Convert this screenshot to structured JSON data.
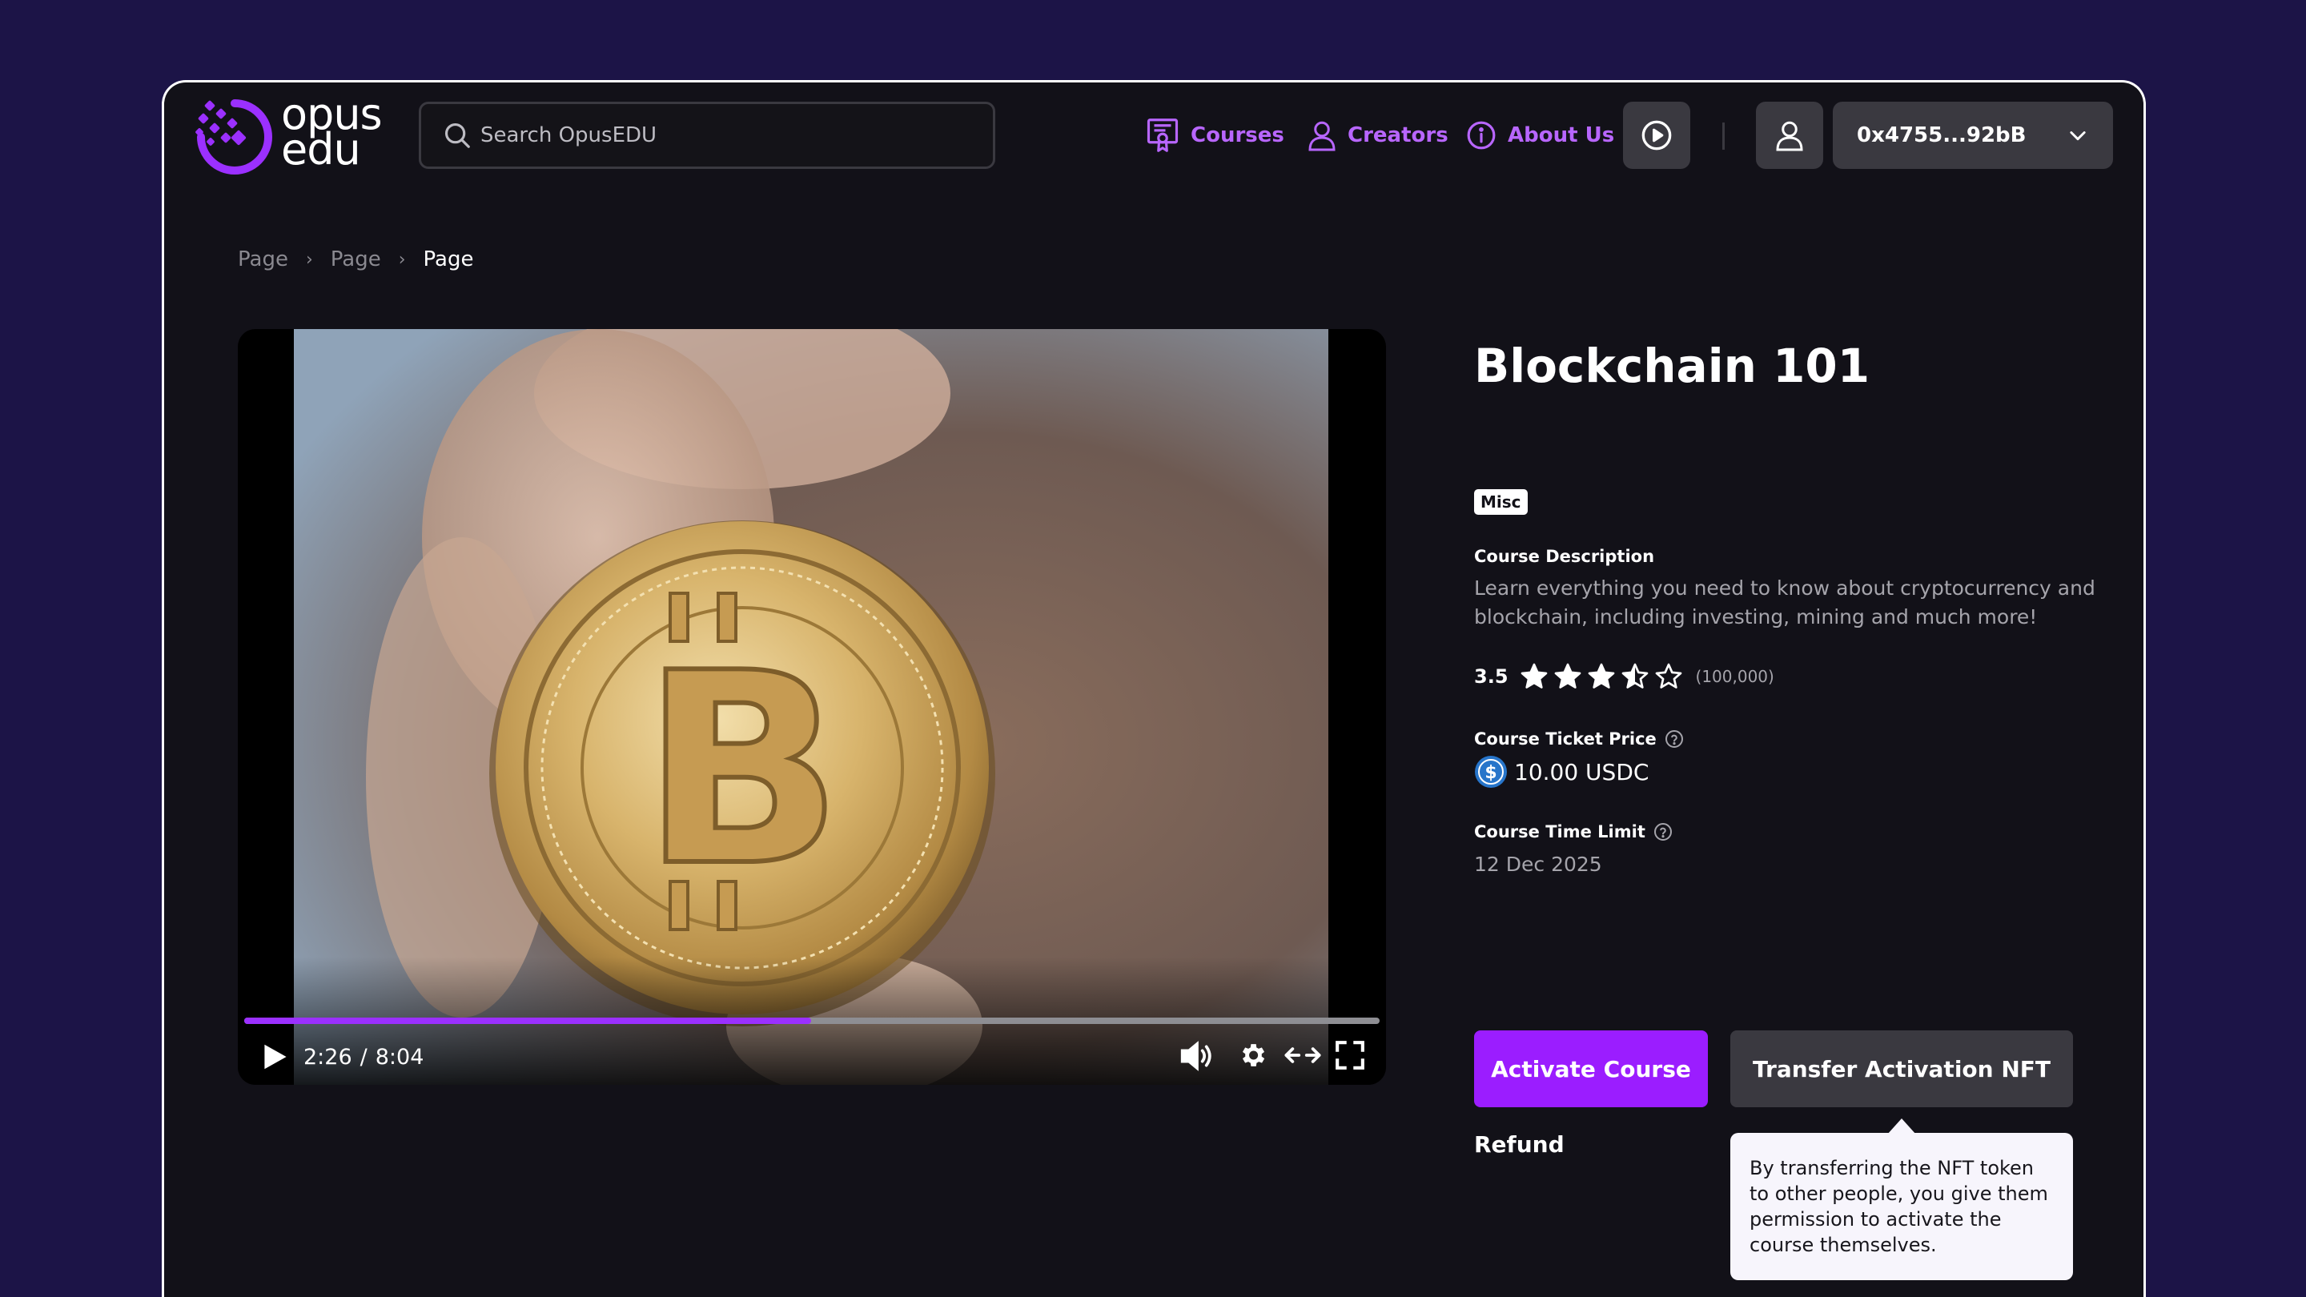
{
  "header": {
    "logo_line1": "opus",
    "logo_line2": "edu",
    "search_placeholder": "Search OpusEDU",
    "nav": [
      {
        "label": "Courses",
        "icon": "certificate-icon"
      },
      {
        "label": "Creators",
        "icon": "user-icon"
      },
      {
        "label": "About Us",
        "icon": "info-icon"
      }
    ],
    "wallet_address": "0x4755...92bB"
  },
  "breadcrumb": [
    "Page",
    "Page",
    "Page"
  ],
  "video": {
    "current_time": "2:26",
    "separator": "/",
    "duration": "8:04",
    "progress": 0.4995
  },
  "course": {
    "title": "Blockchain 101",
    "tag": "Misc",
    "description_label": "Course Description",
    "description": "Learn everything you need to know about cryptocurrency and blockchain, including investing, mining and much more!",
    "rating": "3.5",
    "rating_value": 3.5,
    "rating_max": 5,
    "rating_count": "(100,000)",
    "price_label": "Course Ticket Price",
    "price": "10.00 USDC",
    "time_limit_label": "Course Time Limit",
    "time_limit": "12 Dec 2025",
    "activate_label": "Activate Course",
    "transfer_label": "Transfer Activation NFT",
    "refund_label": "Refund",
    "tooltip": "By transferring the NFT token to other people, you give them permission to activate the course themselves."
  },
  "colors": {
    "background": "#1c1447",
    "surface": "#121118",
    "accent": "#9b1dff",
    "nav_link": "#b866ff",
    "muted": "#a5a4ab"
  }
}
